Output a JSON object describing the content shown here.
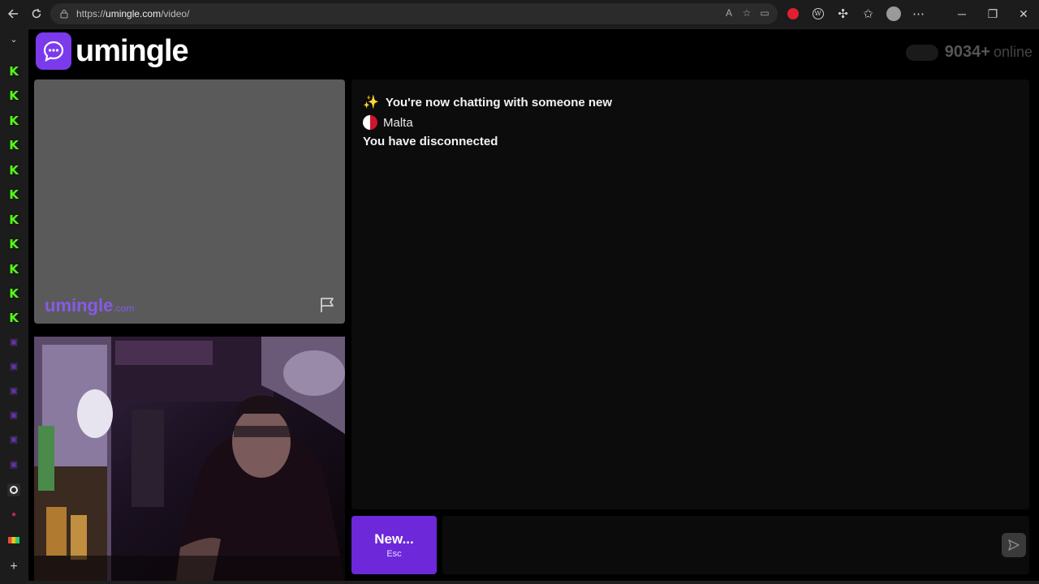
{
  "browser": {
    "url_prefix": "https://",
    "url_host": "umingle.com",
    "url_path": "/video/"
  },
  "app": {
    "logo_text": "umingle",
    "online_count": "9034+",
    "online_label": "online",
    "watermark_main": "umingle",
    "watermark_suffix": ".com"
  },
  "chat": {
    "messages": [
      {
        "text": "You're now chatting with someone new",
        "icon": "sparkle-icon"
      },
      {
        "text": "Malta",
        "icon": "malta-flag-icon"
      },
      {
        "text": "You have disconnected"
      }
    ]
  },
  "controls": {
    "new_label": "New...",
    "new_hint": "Esc",
    "input_placeholder": ""
  },
  "colors": {
    "brand": "#7c3aed",
    "new_button": "#6d28d9",
    "kick_green": "#53fc18"
  }
}
